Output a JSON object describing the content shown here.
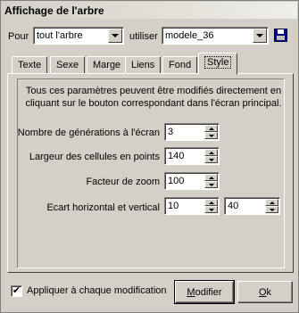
{
  "window": {
    "title": "Affichage de l'arbre"
  },
  "top": {
    "pour_label": "Pour",
    "pour_value": "tout l'arbre",
    "utiliser_label": "utiliser",
    "utiliser_value": "modele_36",
    "save_icon": "floppy-disk-icon"
  },
  "tabs": [
    {
      "label": "Texte",
      "active": false
    },
    {
      "label": "Sexe",
      "active": false
    },
    {
      "label": "Marge",
      "active": false
    },
    {
      "label": "Liens",
      "active": false
    },
    {
      "label": "Fond",
      "active": false
    },
    {
      "label": "Style",
      "active": true
    }
  ],
  "style_tab": {
    "info_line1": "Tous ces paramètres peuvent être modifiés directement en",
    "info_line2": "cliquant sur le bouton correspondant dans l'écran principal.",
    "fields": [
      {
        "label": "Nombre de générations à l'écran",
        "value": "3"
      },
      {
        "label": "Largeur des cellules en points",
        "value": "140"
      },
      {
        "label": "Facteur de zoom",
        "value": "100"
      },
      {
        "label": "Ecart horizontal et vertical",
        "value": "10",
        "value2": "40"
      }
    ]
  },
  "footer": {
    "checkbox_label": "Appliquer à chaque modification",
    "checkbox_checked": true,
    "check_mark": "✔",
    "modifier_first": "M",
    "modifier_rest": "odifier",
    "ok_first": "O",
    "ok_rest": "k"
  }
}
